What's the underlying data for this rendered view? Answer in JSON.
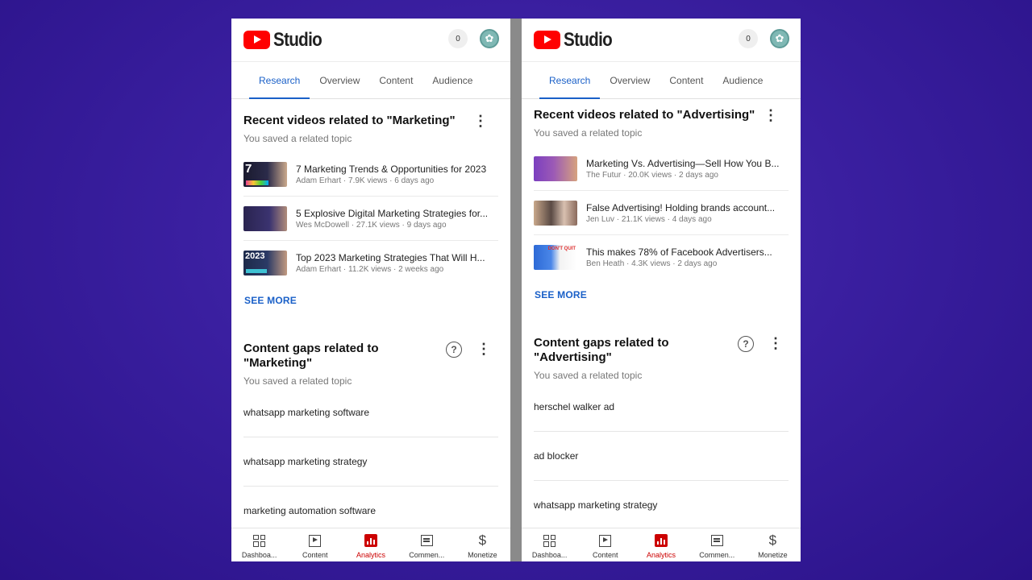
{
  "app": {
    "logo_text": "Studio",
    "notification_count": "0"
  },
  "tabs": [
    "Research",
    "Overview",
    "Content",
    "Audience"
  ],
  "bottom_nav": [
    "Dashboa...",
    "Content",
    "Analytics",
    "Commen...",
    "Monetize"
  ],
  "colors": {
    "accent_blue": "#1a60c8",
    "youtube_red": "#ff0000",
    "analytics_red": "#cc0000"
  },
  "left": {
    "recent_title": "Recent videos related to \"Marketing\"",
    "recent_sub": "You saved a related topic",
    "videos": [
      {
        "title": "7 Marketing Trends & Opportunities for 2023",
        "meta": "Adam Erhart · 7.9K views · 6 days ago",
        "thumb_text": "7"
      },
      {
        "title": "5 Explosive Digital Marketing Strategies for...",
        "meta": "Wes McDowell · 27.1K views · 9 days ago",
        "thumb_text": ""
      },
      {
        "title": "Top 2023 Marketing Strategies That Will H...",
        "meta": "Adam Erhart · 11.2K views · 2 weeks ago",
        "thumb_text": "2023"
      }
    ],
    "see_more": "SEE MORE",
    "gaps_title": "Content gaps related to \"Marketing\"",
    "gaps_sub": "You saved a related topic",
    "gaps": [
      "whatsapp marketing software",
      "whatsapp marketing strategy",
      "marketing automation software"
    ]
  },
  "right": {
    "recent_title": "Recent videos related to \"Advertising\"",
    "recent_sub": "You saved a related topic",
    "videos": [
      {
        "title": "Marketing Vs. Advertising—Sell How You B...",
        "meta": "The Futur · 20.0K views · 2 days ago",
        "thumb_text": ""
      },
      {
        "title": "False Advertising! Holding brands account...",
        "meta": "Jen Luv · 21.1K views · 4 days ago",
        "thumb_text": ""
      },
      {
        "title": "This makes 78% of Facebook Advertisers...",
        "meta": "Ben Heath · 4.3K views · 2 days ago",
        "thumb_text": "DON'T QUIT"
      }
    ],
    "see_more": "SEE MORE",
    "gaps_title": "Content gaps related to \"Advertising\"",
    "gaps_sub": "You saved a related topic",
    "gaps": [
      "herschel walker ad",
      "ad blocker",
      "whatsapp marketing strategy"
    ]
  }
}
